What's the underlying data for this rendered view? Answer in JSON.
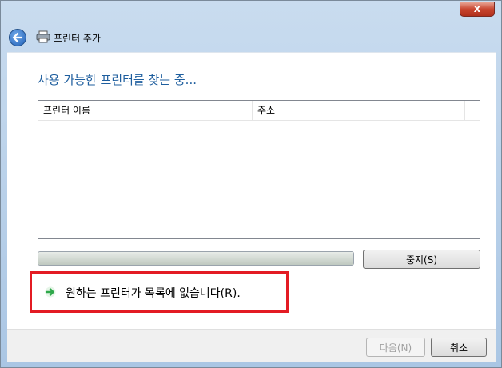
{
  "window": {
    "close_label": "x",
    "title": "프린터 추가"
  },
  "main": {
    "heading": "사용 가능한 프린터를 찾는 중...",
    "list": {
      "columns": [
        "프린터 이름",
        "주소"
      ],
      "rows": []
    },
    "progress": {
      "state": "searching",
      "indeterminate": true
    },
    "stop_button_label": "중지(S)",
    "missing_printer_link": "원하는 프린터가 목록에 없습니다(R)."
  },
  "footer": {
    "next_label": "다음(N)",
    "cancel_label": "취소"
  },
  "colors": {
    "heading": "#1e5e9e",
    "highlight_border": "#e31b23",
    "link_arrow": "#2fa84a"
  },
  "icons": {
    "back": "back-arrow-icon",
    "printer": "printer-icon",
    "link": "green-arrow-icon",
    "close": "close-icon"
  }
}
